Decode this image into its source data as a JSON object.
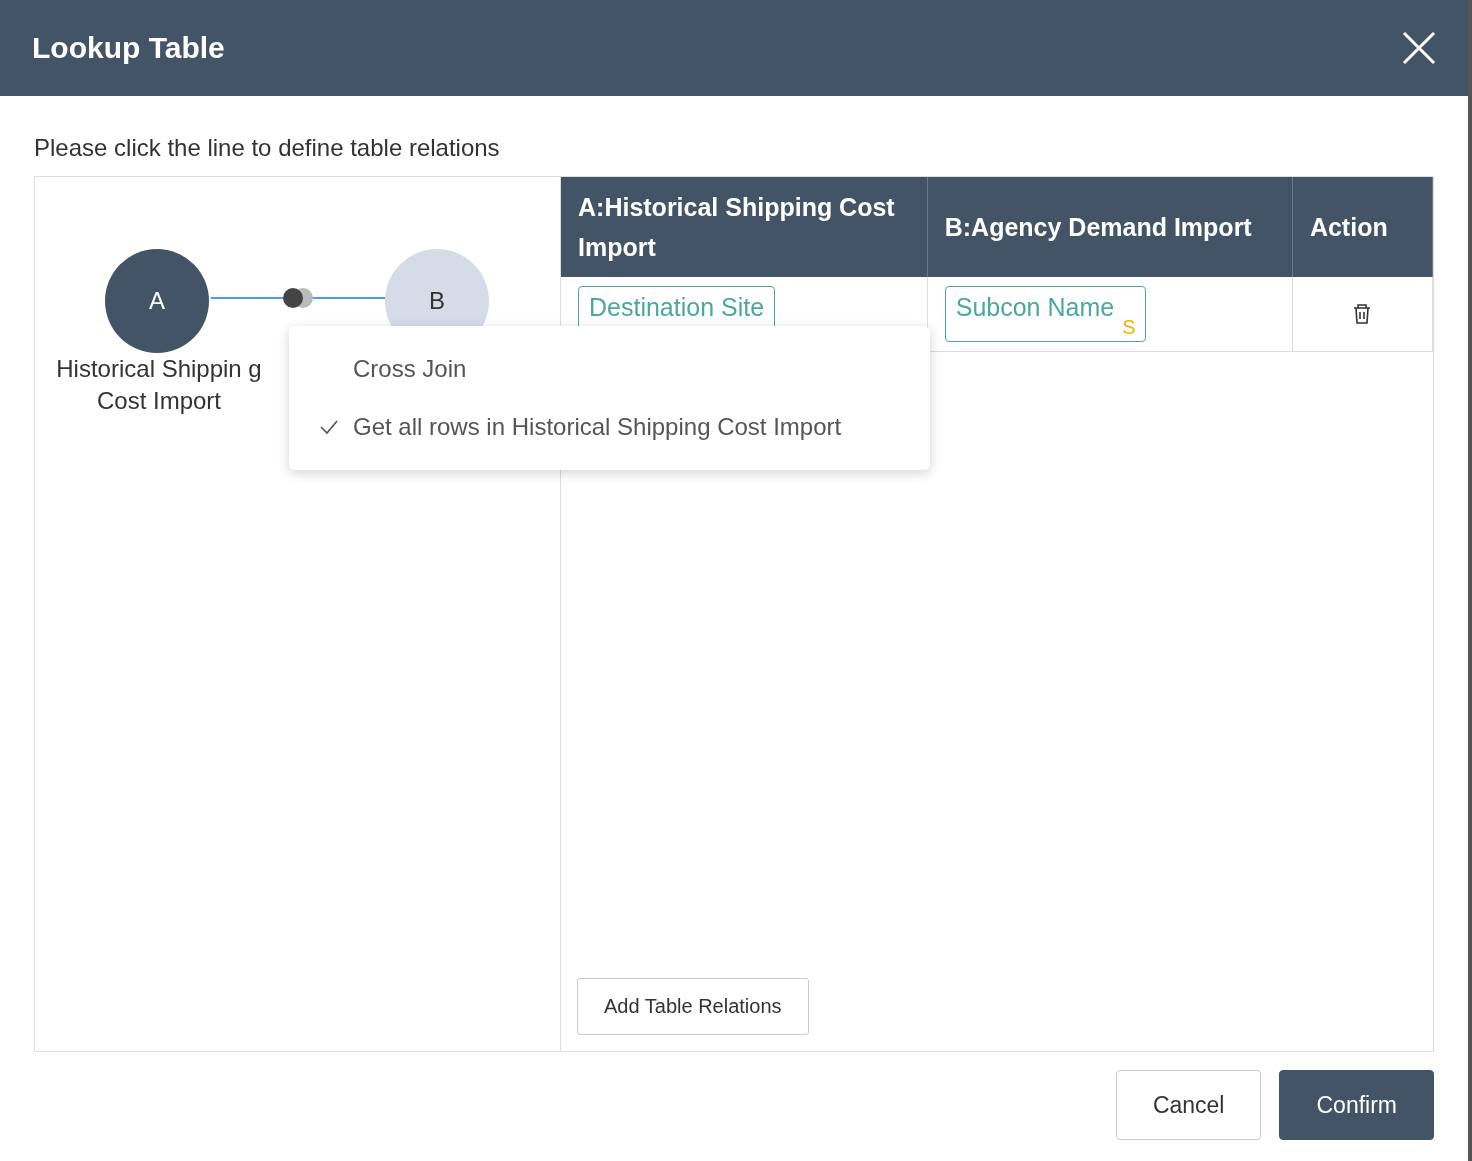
{
  "window": {
    "title": "Lookup Table"
  },
  "instruction": "Please click the line to define table relations",
  "diagram": {
    "nodes": [
      {
        "letter": "A",
        "name": "Historical Shippin g Cost Import",
        "selected": true
      },
      {
        "letter": "B",
        "selected": false
      }
    ]
  },
  "join_menu": [
    {
      "label": "Cross Join",
      "checked": false
    },
    {
      "label": "Get all rows in Historical Shipping Cost Import",
      "checked": true
    }
  ],
  "table": {
    "columns": [
      "A:Historical Shipping Cost Import",
      "B:Agency Demand Import",
      "Action"
    ],
    "rows": [
      {
        "a_field": "Destination Site",
        "b_field": "Subcon Name",
        "b_type": "S"
      }
    ]
  },
  "add_button": "Add Table Relations",
  "buttons": [
    {
      "label": "Cancel",
      "kind": "secondary"
    },
    {
      "label": "Confirm",
      "kind": "primary"
    }
  ]
}
